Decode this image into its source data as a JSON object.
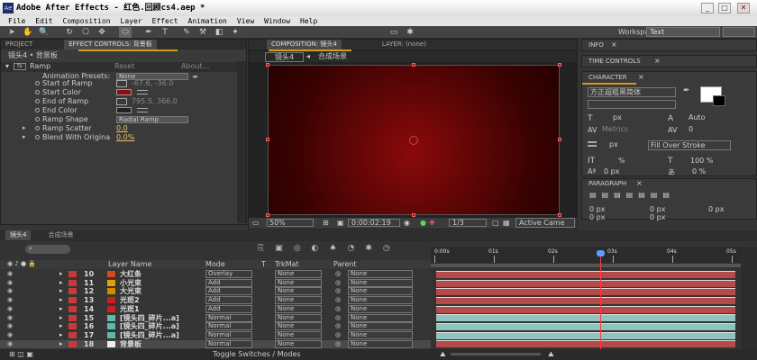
{
  "window": {
    "title": "Adobe After Effects - 红色.回顾cs4.aep *",
    "icon_label": "Ae",
    "minimize": "_",
    "maximize": "□",
    "close": "✕"
  },
  "menu": [
    "File",
    "Edit",
    "Composition",
    "Layer",
    "Effect",
    "Animation",
    "View",
    "Window",
    "Help"
  ],
  "toolbar": {
    "workspace_label": "Workspace:",
    "workspace_value": "Text"
  },
  "left_panel": {
    "tab_project": "PROJECT",
    "tab_effect_controls": "EFFECT CONTROLS: 背景板",
    "subtitle": "镜头4 • 背景板",
    "effect_name": "Ramp",
    "reset": "Reset",
    "about": "About...",
    "rows": [
      {
        "label": "Animation Presets:",
        "value": "None"
      },
      {
        "label": "Start of Ramp",
        "value": "-67.6, -36.0"
      },
      {
        "label": "Start Color",
        "value": ""
      },
      {
        "label": "End of Ramp",
        "value": "795.5, 366.0"
      },
      {
        "label": "End Color",
        "value": ""
      },
      {
        "label": "Ramp Shape",
        "value": "Radial Ramp"
      },
      {
        "label": "Ramp Scatter",
        "value": "0.0"
      },
      {
        "label": "Blend With Origina",
        "value": "0.0%"
      }
    ]
  },
  "comp_panel": {
    "tab_comp": "COMPOSITION: 镜头4",
    "tab_layer": "LAYER: (none)",
    "breadcrumb1": "镜头4",
    "breadcrumb2": "合成场景",
    "zoom": "50%",
    "timecode": "0:00:02:19",
    "resolution": "1/3",
    "camera": "Active Came"
  },
  "right_panels": {
    "info": "INFO",
    "time_controls": "TIME CONTROLS",
    "character": "CHARACTER",
    "font": "方正超粗黑简体",
    "font_size": "px",
    "leading": "Auto",
    "metrics": "Metrics",
    "tracking": "0",
    "stroke_size": "px",
    "stroke_mode": "Fill Over Stroke",
    "vscale": "%",
    "hscale": "100 %",
    "baseline": "0 px",
    "tsume": "0 %",
    "paragraph": "PARAGRAPH",
    "indent1": "0 px",
    "indent2": "0 px",
    "indent3": "0 px",
    "space1": "0 px",
    "space2": "0 px"
  },
  "timeline": {
    "tab1": "镜头4",
    "tab2": "合成场景",
    "toggle_label": "Toggle Switches / Modes",
    "headers": {
      "layer_name": "Layer Name",
      "mode": "Mode",
      "t": "T",
      "trkmat": "TrkMat",
      "parent": "Parent"
    },
    "ruler": [
      "0:00s",
      "01s",
      "02s",
      "03s",
      "04s",
      "05s"
    ],
    "layers": [
      {
        "num": "10",
        "name": "大红条",
        "color": "#d44a1f",
        "mode": "Overlay",
        "trkmat": "None",
        "parent": "None",
        "bar": "red"
      },
      {
        "num": "11",
        "name": "小光束",
        "color": "#e3a000",
        "mode": "Add",
        "trkmat": "None",
        "parent": "None",
        "bar": "red"
      },
      {
        "num": "12",
        "name": "大光束",
        "color": "#d68a00",
        "mode": "Add",
        "trkmat": "None",
        "parent": "None",
        "bar": "red"
      },
      {
        "num": "13",
        "name": "光斑2",
        "color": "#c8201c",
        "mode": "Add",
        "trkmat": "None",
        "parent": "None",
        "bar": "red"
      },
      {
        "num": "14",
        "name": "光斑1",
        "color": "#c8201c",
        "mode": "Add",
        "trkmat": "None",
        "parent": "None",
        "bar": "red"
      },
      {
        "num": "15",
        "name": "[镜头四_碎片...a]",
        "color": "#5fb8a8",
        "mode": "Normal",
        "trkmat": "None",
        "parent": "None",
        "bar": "teal"
      },
      {
        "num": "16",
        "name": "[镜头四_碎片...a]",
        "color": "#5fb8a8",
        "mode": "Normal",
        "trkmat": "None",
        "parent": "None",
        "bar": "teal"
      },
      {
        "num": "17",
        "name": "[镜头四_碎片...a]",
        "color": "#5fb8a8",
        "mode": "Normal",
        "trkmat": "None",
        "parent": "None",
        "bar": "teal"
      },
      {
        "num": "18",
        "name": "背景板",
        "color": "#eeeeee",
        "mode": "Normal",
        "trkmat": "None",
        "parent": "None",
        "bar": "red"
      }
    ]
  },
  "colors": {
    "start_color": "#8c0d0d",
    "end_color": "#222222",
    "red_bar": "#b44a4a",
    "teal_bar": "#8fc4be",
    "playhead": "#ff3a3a"
  }
}
